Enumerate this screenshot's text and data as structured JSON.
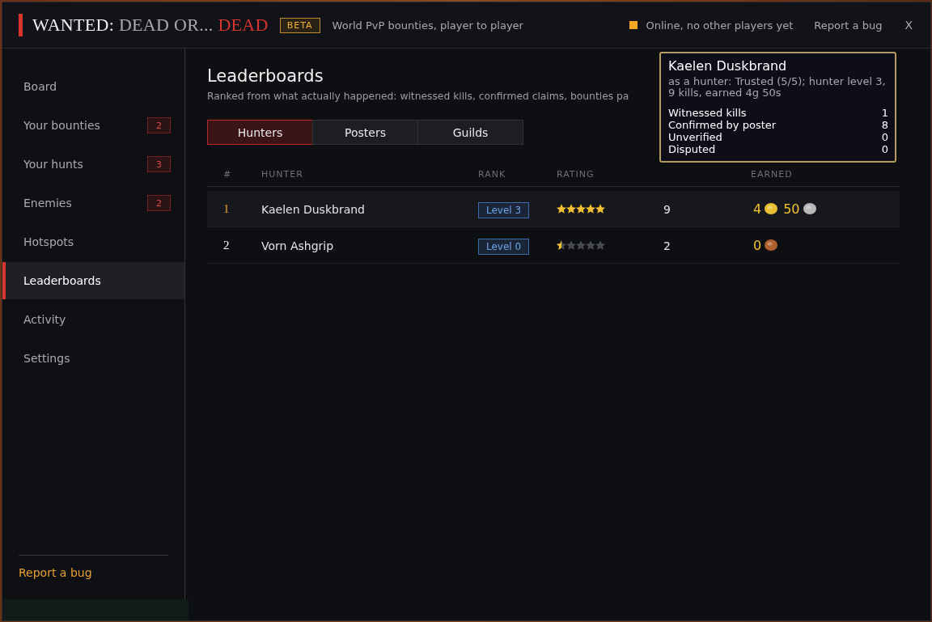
{
  "header": {
    "title_parts": [
      {
        "text": "WANTED:",
        "color": "#f0f0f0"
      },
      {
        "text": "DEAD OR...",
        "color": "#a9a9b3"
      },
      {
        "text": "DEAD",
        "color": "#d8352e"
      }
    ],
    "badge": "BETA",
    "tagline": "World PvP bounties, player to player",
    "status": {
      "text": "Online, no other players yet",
      "color": "#f5a623"
    },
    "report": "Report a bug",
    "close": "X"
  },
  "sidebar": {
    "items": [
      {
        "label": "Board",
        "selected": false
      },
      {
        "label": "Your bounties",
        "selected": false,
        "count": "2"
      },
      {
        "label": "Your hunts",
        "selected": false,
        "count": "3"
      },
      {
        "label": "Enemies",
        "selected": false,
        "count": "2"
      },
      {
        "label": "Hotspots",
        "selected": false
      },
      {
        "label": "Leaderboards",
        "selected": true
      },
      {
        "label": "Activity",
        "selected": false
      },
      {
        "label": "Settings",
        "selected": false
      }
    ],
    "footer_link": "Report a bug"
  },
  "page": {
    "title": "Leaderboards",
    "subtitle": "Ranked from what actually happened: witnessed kills, confirmed claims, bounties pa",
    "tabs": [
      {
        "label": "Hunters",
        "selected": true
      },
      {
        "label": "Posters",
        "selected": false
      },
      {
        "label": "Guilds",
        "selected": false
      }
    ],
    "columns": {
      "number": "#",
      "hunter": "HUNTER",
      "rank": "RANK",
      "rating": "RATING",
      "earned": "EARNED"
    },
    "rows": [
      {
        "number": "1",
        "top": true,
        "hunter": "Kaelen Duskbrand",
        "rank": "Level 3",
        "stars": 5,
        "kills": "9",
        "earned": [
          {
            "amount": "4",
            "color": "#e8c031"
          },
          {
            "amount": "50",
            "color": "#b8b8b8"
          }
        ]
      },
      {
        "number": "2",
        "top": false,
        "hunter": "Vorn Ashgrip",
        "rank": "Level 0",
        "stars": 0.5,
        "kills": "2",
        "earned": [
          {
            "amount": "0",
            "color": "#b0602e"
          }
        ]
      }
    ]
  },
  "tooltip": {
    "title": "Kaelen Duskbrand",
    "summary": "as a hunter: Trusted (5/5); hunter level 3, 9 kills, earned 4g 50s",
    "stats": [
      {
        "label": "Witnessed kills",
        "value": "1"
      },
      {
        "label": "Confirmed by poster",
        "value": "8"
      },
      {
        "label": "Unverified",
        "value": "0"
      },
      {
        "label": "Disputed",
        "value": "0"
      }
    ]
  }
}
